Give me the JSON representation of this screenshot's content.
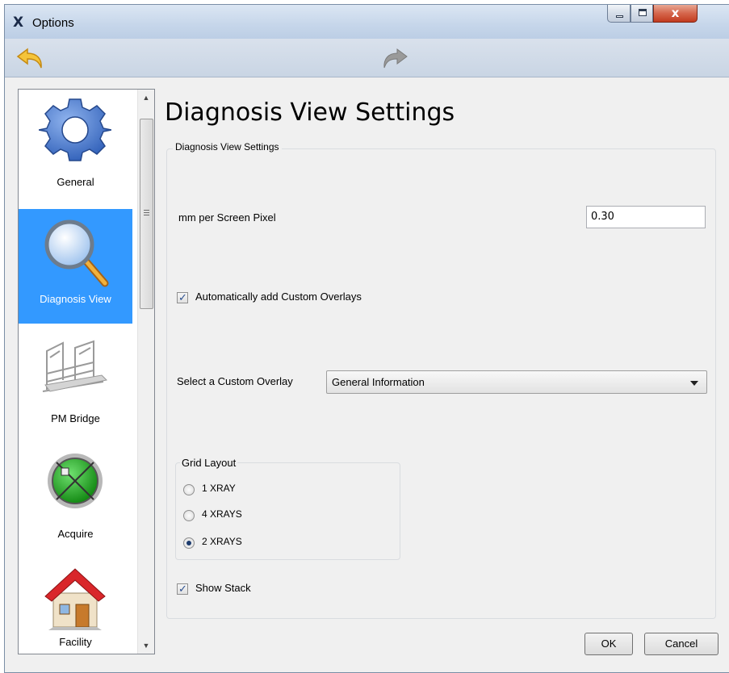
{
  "window": {
    "title": "Options",
    "app_icon_glyph": "X",
    "controls": {
      "minimize": "minimize-icon",
      "maximize": "maximize-icon",
      "close_glyph": "x"
    }
  },
  "toolbar": {
    "back": "back-arrow-icon",
    "forward": "forward-arrow-icon"
  },
  "sidebar": {
    "items": [
      {
        "label": "General",
        "icon": "gear-icon",
        "selected": false
      },
      {
        "label": "Diagnosis View",
        "icon": "magnifier-icon",
        "selected": true
      },
      {
        "label": "PM Bridge",
        "icon": "bridge-icon",
        "selected": false
      },
      {
        "label": "Acquire",
        "icon": "crosshair-icon",
        "selected": false
      },
      {
        "label": "Facility",
        "icon": "house-icon",
        "selected": false
      }
    ]
  },
  "page": {
    "title": "Diagnosis View Settings",
    "group_title": "Diagnosis View Settings",
    "mm_per_pixel_label": "mm per Screen Pixel",
    "mm_per_pixel_value": "0.30",
    "auto_overlays_label": "Automatically add Custom Overlays",
    "auto_overlays_checked": true,
    "custom_overlay_label": "Select a Custom Overlay",
    "custom_overlay_value": "General Information",
    "grid_layout": {
      "title": "Grid Layout",
      "options": [
        "1 XRAY",
        "4 XRAYS",
        "2 XRAYS"
      ],
      "selected": "2 XRAYS"
    },
    "show_stack_label": "Show Stack",
    "show_stack_checked": true
  },
  "buttons": {
    "ok": "OK",
    "cancel": "Cancel"
  },
  "colors": {
    "selection": "#3399ff",
    "titlebar": "#c6d6ea"
  }
}
